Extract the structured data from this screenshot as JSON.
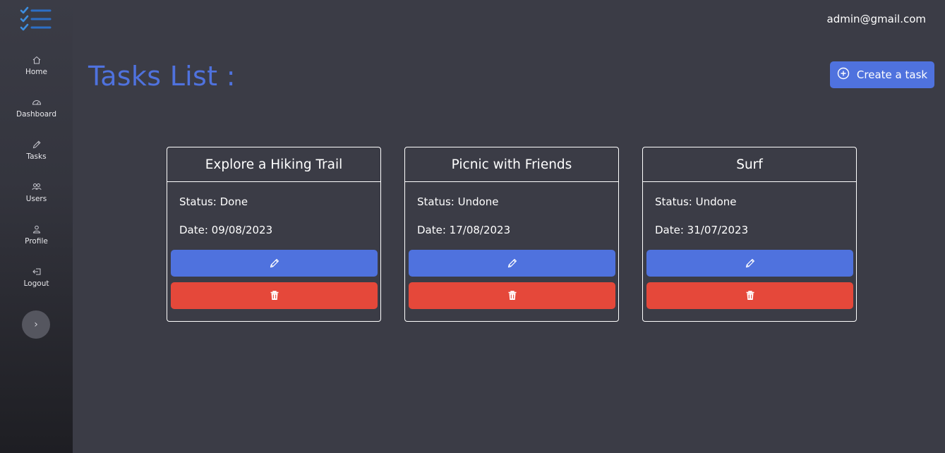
{
  "header": {
    "user_email": "admin@gmail.com"
  },
  "sidebar": {
    "items": [
      {
        "label": "Home",
        "icon": "home-icon"
      },
      {
        "label": "Dashboard",
        "icon": "gauge-icon"
      },
      {
        "label": "Tasks",
        "icon": "pencil-icon"
      },
      {
        "label": "Users",
        "icon": "users-icon"
      },
      {
        "label": "Profile",
        "icon": "user-icon"
      },
      {
        "label": "Logout",
        "icon": "logout-icon"
      }
    ],
    "expand_label": "›"
  },
  "main": {
    "title": "Tasks List :",
    "create_button": "Create a task"
  },
  "tasks": [
    {
      "title": "Explore a Hiking Trail",
      "status": "Status: Done",
      "date": "Date: 09/08/2023"
    },
    {
      "title": "Picnic with Friends",
      "status": "Status: Undone",
      "date": "Date: 17/08/2023"
    },
    {
      "title": "Surf",
      "status": "Status: Undone",
      "date": "Date: 31/07/2023"
    }
  ],
  "colors": {
    "accent": "#4f72de",
    "danger": "#e5483a",
    "background": "#3b3c46"
  }
}
